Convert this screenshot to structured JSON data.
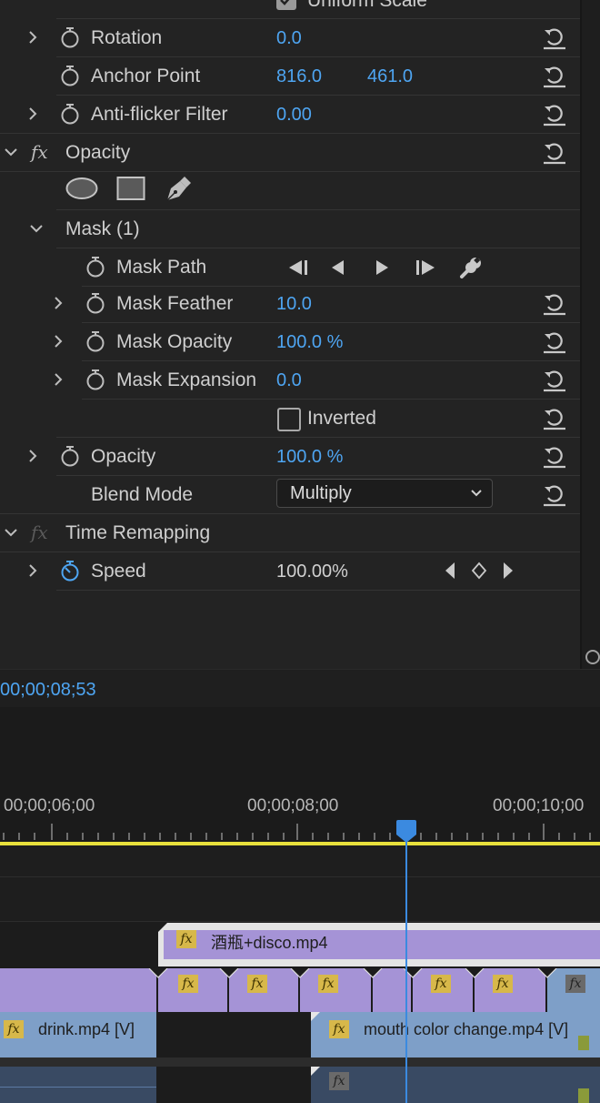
{
  "effect_controls": {
    "partial_top_label": "Uniform Scale",
    "rows": {
      "rotation": {
        "label": "Rotation",
        "value": "0.0"
      },
      "anchor": {
        "label": "Anchor Point",
        "x": "816.0",
        "y": "461.0"
      },
      "antiflicker": {
        "label": "Anti-flicker Filter",
        "value": "0.00"
      },
      "opacity_section": {
        "label": "Opacity"
      },
      "mask": {
        "label": "Mask (1)"
      },
      "mask_path": {
        "label": "Mask Path"
      },
      "mask_feather": {
        "label": "Mask Feather",
        "value": "10.0"
      },
      "mask_opacity": {
        "label": "Mask Opacity",
        "value": "100.0 %"
      },
      "mask_expansion": {
        "label": "Mask Expansion",
        "value": "0.0"
      },
      "inverted": {
        "label": "Inverted",
        "checked": false
      },
      "opacity": {
        "label": "Opacity",
        "value": "100.0 %"
      },
      "blend_mode": {
        "label": "Blend Mode",
        "value": "Multiply"
      },
      "time_remapping": {
        "label": "Time Remapping"
      },
      "speed": {
        "label": "Speed",
        "value": "100.00%"
      }
    },
    "fx_symbol": "fx",
    "current_time": "00;00;08;53"
  },
  "timeline": {
    "ruler": [
      "00;00;06;00",
      "00;00;08;00",
      "00;00;10;00"
    ],
    "clips": {
      "top_clip": "酒瓶+disco.mp4",
      "drink": "drink.mp4 [V]",
      "mouth": "mouth color change.mp4 [V]"
    },
    "fx_symbol": "fx"
  },
  "colors": {
    "accent_blue": "#4ea5f2",
    "work_area_yellow": "#e8e03c",
    "clip_purple": "#a593d6",
    "clip_blue": "#7e9fc8",
    "fx_badge": "#d7b84a"
  }
}
